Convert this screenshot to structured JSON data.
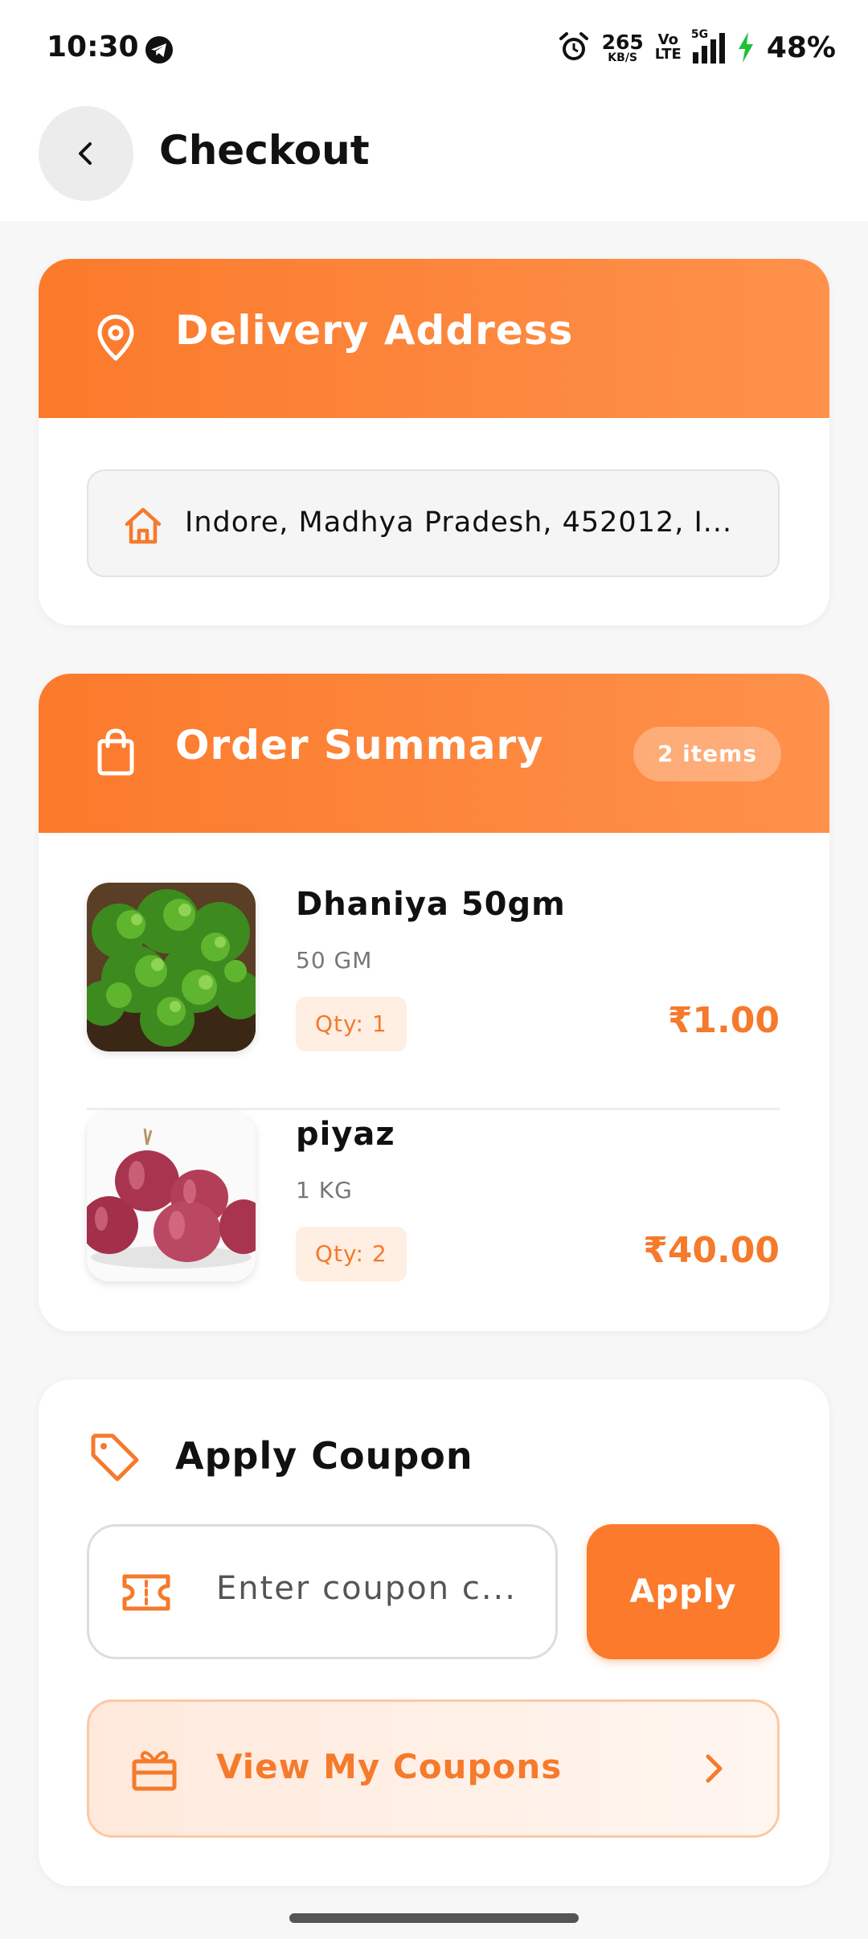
{
  "status_bar": {
    "time": "10:30",
    "net_speed": "265",
    "net_unit": "KB/S",
    "volte_top": "Vo",
    "volte_bottom": "LTE",
    "network": "5G",
    "battery": "48%"
  },
  "header": {
    "title": "Checkout"
  },
  "delivery": {
    "title": "Delivery Address",
    "address": "Indore, Madhya Pradesh, 452012, I..."
  },
  "order_summary": {
    "title": "Order Summary",
    "count_badge": "2 items",
    "items": [
      {
        "name": "Dhaniya 50gm",
        "unit": "50 GM",
        "qty": "Qty: 1",
        "price": "₹1.00"
      },
      {
        "name": "piyaz",
        "unit": "1 KG",
        "qty": "Qty: 2",
        "price": "₹40.00"
      }
    ]
  },
  "coupon": {
    "title": "Apply Coupon",
    "placeholder": "Enter coupon c...",
    "apply_label": "Apply",
    "view_label": "View My Coupons"
  },
  "colors": {
    "accent": "#fb7a2b",
    "accent_light": "#ffeee2",
    "price": "#f57a2c"
  }
}
